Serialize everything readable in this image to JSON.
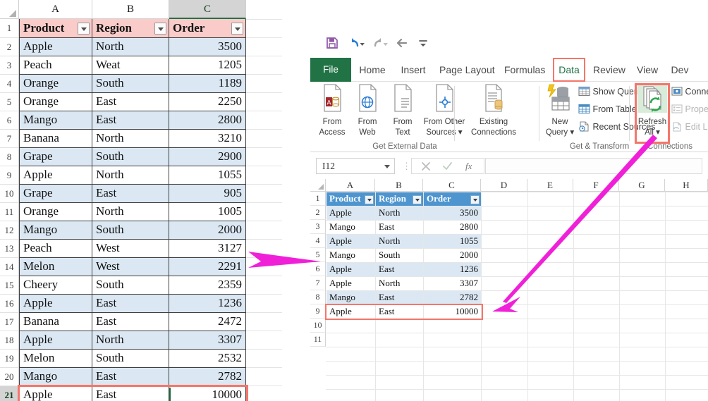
{
  "left_sheet": {
    "columns": [
      "A",
      "B",
      "C"
    ],
    "selected_column": "C",
    "headers": [
      "Product",
      "Region",
      "Order"
    ],
    "rows": [
      {
        "n": 2,
        "product": "Apple",
        "region": "North",
        "order": "3500"
      },
      {
        "n": 3,
        "product": "Peach",
        "region": "Weat",
        "order": "1205"
      },
      {
        "n": 4,
        "product": "Orange",
        "region": "South",
        "order": "1189"
      },
      {
        "n": 5,
        "product": "Orange",
        "region": "East",
        "order": "2250"
      },
      {
        "n": 6,
        "product": "Mango",
        "region": "East",
        "order": "2800"
      },
      {
        "n": 7,
        "product": "Banana",
        "region": "North",
        "order": "3210"
      },
      {
        "n": 8,
        "product": "Grape",
        "region": "South",
        "order": "2900"
      },
      {
        "n": 9,
        "product": "Apple",
        "region": "North",
        "order": "1055"
      },
      {
        "n": 10,
        "product": "Grape",
        "region": "East",
        "order": "905"
      },
      {
        "n": 11,
        "product": "Orange",
        "region": "North",
        "order": "1005"
      },
      {
        "n": 12,
        "product": "Mango",
        "region": "South",
        "order": "2000"
      },
      {
        "n": 13,
        "product": "Peach",
        "region": "West",
        "order": "3127"
      },
      {
        "n": 14,
        "product": "Melon",
        "region": "West",
        "order": "2291"
      },
      {
        "n": 15,
        "product": "Cheery",
        "region": "South",
        "order": "2359"
      },
      {
        "n": 16,
        "product": "Apple",
        "region": "East",
        "order": "1236"
      },
      {
        "n": 17,
        "product": "Banana",
        "region": "East",
        "order": "2472"
      },
      {
        "n": 18,
        "product": "Apple",
        "region": "North",
        "order": "3307"
      },
      {
        "n": 19,
        "product": "Melon",
        "region": "South",
        "order": "2532"
      },
      {
        "n": 20,
        "product": "Mango",
        "region": "East",
        "order": "2782"
      },
      {
        "n": 21,
        "product": "Apple",
        "region": "East",
        "order": "10000"
      }
    ],
    "highlighted_row": 21,
    "header_fill": "#f9ccca",
    "band_fill": "#dbe8f4",
    "highlight_color": "#f4766a"
  },
  "excel": {
    "quick_access": [
      {
        "name": "save-icon",
        "label": "Save"
      },
      {
        "name": "undo-icon",
        "label": "Undo"
      },
      {
        "name": "redo-icon",
        "label": "Redo"
      },
      {
        "name": "back-icon",
        "label": "Back"
      },
      {
        "name": "customize-icon",
        "label": "Customize Quick Access Toolbar"
      }
    ],
    "tabs": [
      {
        "label": "File",
        "active": false,
        "file": true
      },
      {
        "label": "Home",
        "active": false
      },
      {
        "label": "Insert",
        "active": false
      },
      {
        "label": "Page Layout",
        "active": false
      },
      {
        "label": "Formulas",
        "active": false
      },
      {
        "label": "Data",
        "active": true
      },
      {
        "label": "Review",
        "active": false
      },
      {
        "label": "View",
        "active": false
      },
      {
        "label": "Dev",
        "active": false
      }
    ],
    "active_tab": "Data",
    "accent_green": "#217346",
    "ribbon": {
      "groups": [
        {
          "label": "Get External Data",
          "big_buttons": [
            {
              "name": "from-access-button",
              "line1": "From",
              "line2": "Access",
              "icon": "access-db-icon"
            },
            {
              "name": "from-web-button",
              "line1": "From",
              "line2": "Web",
              "icon": "globe-icon"
            },
            {
              "name": "from-text-button",
              "line1": "From",
              "line2": "Text",
              "icon": "text-file-icon"
            },
            {
              "name": "from-other-sources-button",
              "line1": "From Other",
              "line2": "Sources ▾",
              "icon": "other-sources-icon"
            }
          ]
        },
        {
          "label": "",
          "big_buttons": [
            {
              "name": "existing-connections-button",
              "line1": "Existing",
              "line2": "Connections",
              "icon": "database-doc-icon"
            }
          ]
        },
        {
          "label": "Get & Transform",
          "big_buttons": [
            {
              "name": "new-query-button",
              "line1": "New",
              "line2": "Query ▾",
              "icon": "new-query-icon"
            }
          ],
          "small_buttons": [
            {
              "name": "show-queries-button",
              "label": "Show Queries",
              "icon": "show-queries-icon",
              "dim": false
            },
            {
              "name": "from-table-button",
              "label": "From Table",
              "icon": "from-table-icon",
              "dim": false
            },
            {
              "name": "recent-sources-button",
              "label": "Recent Sources",
              "icon": "recent-sources-icon",
              "dim": false
            }
          ]
        },
        {
          "label": "Connections",
          "big_buttons": [
            {
              "name": "refresh-all-button",
              "line1": "Refresh",
              "line2": "All ▾",
              "icon": "refresh-icon",
              "highlighted": true
            }
          ],
          "small_buttons": [
            {
              "name": "connections-button",
              "label": "Connec",
              "icon": "connections-icon",
              "dim": false
            },
            {
              "name": "properties-button",
              "label": "Propert",
              "icon": "properties-icon",
              "dim": true
            },
            {
              "name": "edit-links-button",
              "label": "Edit Lin",
              "icon": "edit-links-icon",
              "dim": true
            }
          ]
        }
      ]
    },
    "formula_bar": {
      "name_box_value": "I12",
      "formula_value": "",
      "cancel_icon": "cancel-icon",
      "enter_icon": "enter-icon",
      "function_icon": "insert-function-icon"
    },
    "grid": {
      "columns": [
        "A",
        "B",
        "C",
        "D",
        "E",
        "F",
        "G",
        "H"
      ],
      "headers": [
        "Product",
        "Region",
        "Order"
      ],
      "rows": [
        {
          "n": 2,
          "product": "Apple",
          "region": "North",
          "order": "3500"
        },
        {
          "n": 3,
          "product": "Mango",
          "region": "East",
          "order": "2800"
        },
        {
          "n": 4,
          "product": "Apple",
          "region": "North",
          "order": "1055"
        },
        {
          "n": 5,
          "product": "Mango",
          "region": "South",
          "order": "2000"
        },
        {
          "n": 6,
          "product": "Apple",
          "region": "East",
          "order": "1236"
        },
        {
          "n": 7,
          "product": "Apple",
          "region": "North",
          "order": "3307"
        },
        {
          "n": 8,
          "product": "Mango",
          "region": "East",
          "order": "2782"
        },
        {
          "n": 9,
          "product": "Apple",
          "region": "East",
          "order": "10000"
        }
      ],
      "empty_rows": [
        10,
        11
      ],
      "highlighted_row": 9,
      "header_fill": "#4e95cf",
      "band_fill": "#dbe8f4"
    }
  },
  "annotations": {
    "arrow_color": "#f020d8",
    "arrows": [
      {
        "name": "arrow-source-to-result",
        "from": "left-table",
        "to": "right-table-row-4"
      },
      {
        "name": "arrow-refresh-to-row",
        "from": "refresh-all-button",
        "to": "right-table-row-9"
      }
    ]
  }
}
